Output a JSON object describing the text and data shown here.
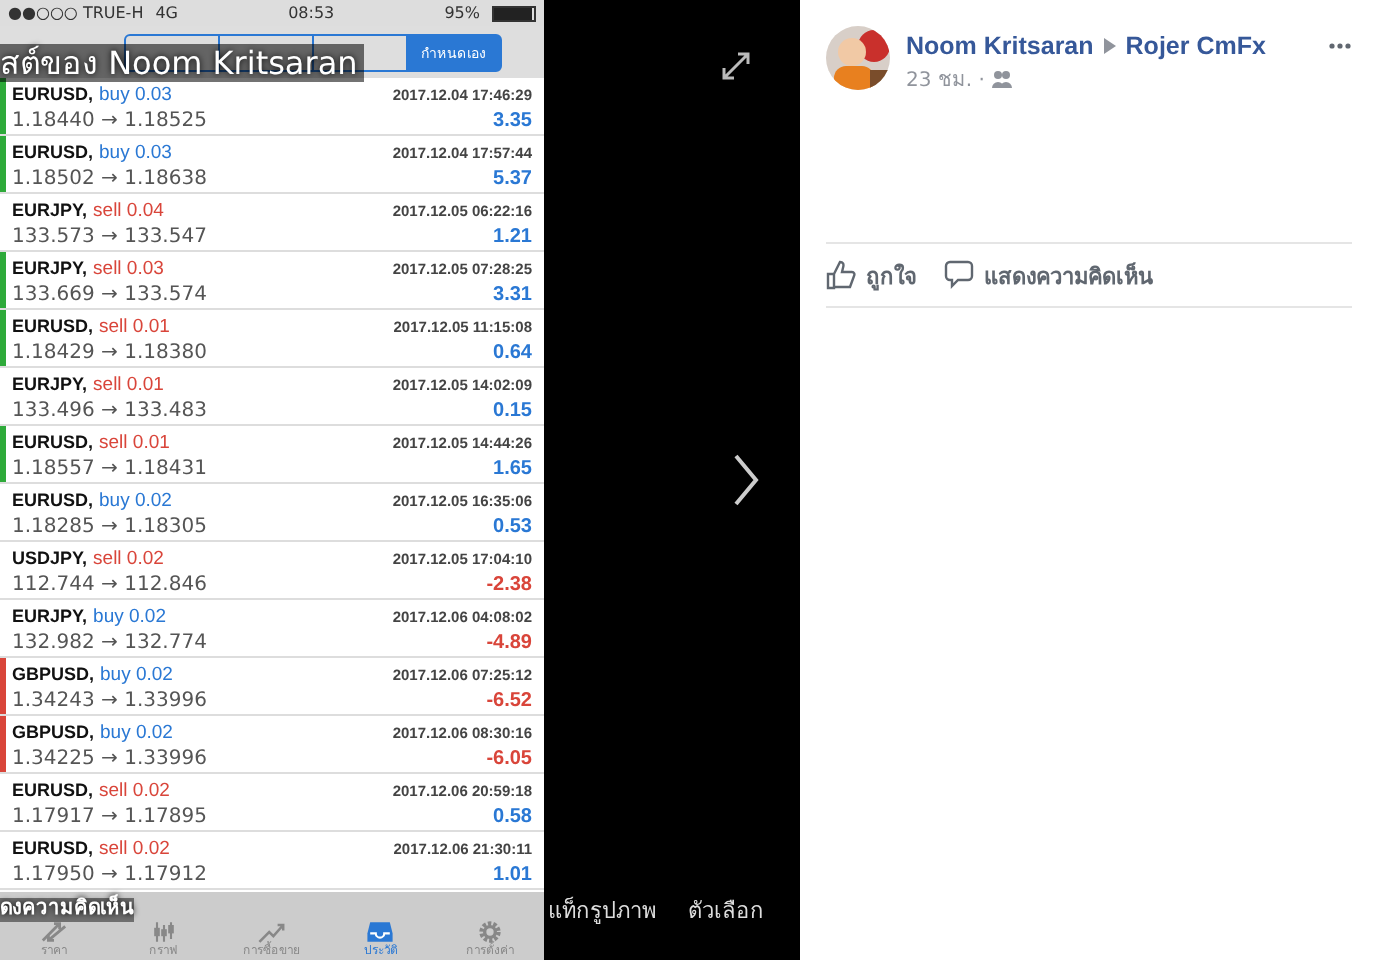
{
  "phone": {
    "status_bar": {
      "carrier": "●●○○○ TRUE-H",
      "network": "4G",
      "time": "08:53",
      "battery": "95%",
      "level": 0.95
    },
    "segment": {
      "label": "กำหนดเอง",
      "selected": true
    },
    "trades": [
      {
        "pair": "EURUSD,",
        "side": "buy",
        "lots": "0.03",
        "time": "2017.12.04 17:46:29",
        "prices": "1.18440 → 1.18525",
        "profit": "3.35",
        "loss": false,
        "color": "#2eaa3a"
      },
      {
        "pair": "EURUSD,",
        "side": "buy",
        "lots": "0.03",
        "time": "2017.12.04 17:57:44",
        "prices": "1.18502 → 1.18638",
        "profit": "5.37",
        "loss": false,
        "color": "#2eaa3a"
      },
      {
        "pair": "EURJPY,",
        "side": "sell",
        "lots": "0.04",
        "time": "2017.12.05 06:22:16",
        "prices": "133.573 → 133.547",
        "profit": "1.21",
        "loss": false
      },
      {
        "pair": "EURJPY,",
        "side": "sell",
        "lots": "0.03",
        "time": "2017.12.05 07:28:25",
        "prices": "133.669 → 133.574",
        "profit": "3.31",
        "loss": false,
        "color": "#2eaa3a"
      },
      {
        "pair": "EURUSD,",
        "side": "sell",
        "lots": "0.01",
        "time": "2017.12.05 11:15:08",
        "prices": "1.18429 → 1.18380",
        "profit": "0.64",
        "loss": false,
        "color": "#2eaa3a"
      },
      {
        "pair": "EURJPY,",
        "side": "sell",
        "lots": "0.01",
        "time": "2017.12.05 14:02:09",
        "prices": "133.496 → 133.483",
        "profit": "0.15",
        "loss": false
      },
      {
        "pair": "EURUSD,",
        "side": "sell",
        "lots": "0.01",
        "time": "2017.12.05 14:44:26",
        "prices": "1.18557 → 1.18431",
        "profit": "1.65",
        "loss": false,
        "color": "#2eaa3a"
      },
      {
        "pair": "EURUSD,",
        "side": "buy",
        "lots": "0.02",
        "time": "2017.12.05 16:35:06",
        "prices": "1.18285 → 1.18305",
        "profit": "0.53",
        "loss": false
      },
      {
        "pair": "USDJPY,",
        "side": "sell",
        "lots": "0.02",
        "time": "2017.12.05 17:04:10",
        "prices": "112.744 → 112.846",
        "profit": "-2.38",
        "loss": true
      },
      {
        "pair": "EURJPY,",
        "side": "buy",
        "lots": "0.02",
        "time": "2017.12.06 04:08:02",
        "prices": "132.982 → 132.774",
        "profit": "-4.89",
        "loss": true
      },
      {
        "pair": "GBPUSD,",
        "side": "buy",
        "lots": "0.02",
        "time": "2017.12.06 07:25:12",
        "prices": "1.34243 → 1.33996",
        "profit": "-6.52",
        "loss": true,
        "color": "#d9453a"
      },
      {
        "pair": "GBPUSD,",
        "side": "buy",
        "lots": "0.02",
        "time": "2017.12.06 08:30:16",
        "prices": "1.34225 → 1.33996",
        "profit": "-6.05",
        "loss": true,
        "color": "#d9453a"
      },
      {
        "pair": "EURUSD,",
        "side": "sell",
        "lots": "0.02",
        "time": "2017.12.06 20:59:18",
        "prices": "1.17917 → 1.17895",
        "profit": "0.58",
        "loss": false
      },
      {
        "pair": "EURUSD,",
        "side": "sell",
        "lots": "0.02",
        "time": "2017.12.06 21:30:11",
        "prices": "1.17950 → 1.17912",
        "profit": "1.01",
        "loss": false
      }
    ],
    "tabbar": [
      {
        "kind": "quotes",
        "label": "ราคา",
        "selected": false
      },
      {
        "kind": "chart",
        "label": "กราฟ",
        "selected": false
      },
      {
        "kind": "trade",
        "label": "การซื้อขาย",
        "selected": false
      },
      {
        "kind": "history",
        "label": "ประวัติ",
        "selected": true
      },
      {
        "kind": "settings",
        "label": "การตั้งค่า",
        "selected": false
      }
    ]
  },
  "viewer": {
    "caption": "สต์ของ Noom Kritsaran",
    "comment": "ดงความคิดเห็น",
    "tag_photo": "แท็กรูปภาพ",
    "options": "ตัวเลือก"
  },
  "post": {
    "author": "Noom Kritsaran",
    "target": "Rojer CmFx",
    "time": "23 ชม. ·",
    "like": "ถูกใจ",
    "comment": "แสดงความคิดเห็น"
  }
}
